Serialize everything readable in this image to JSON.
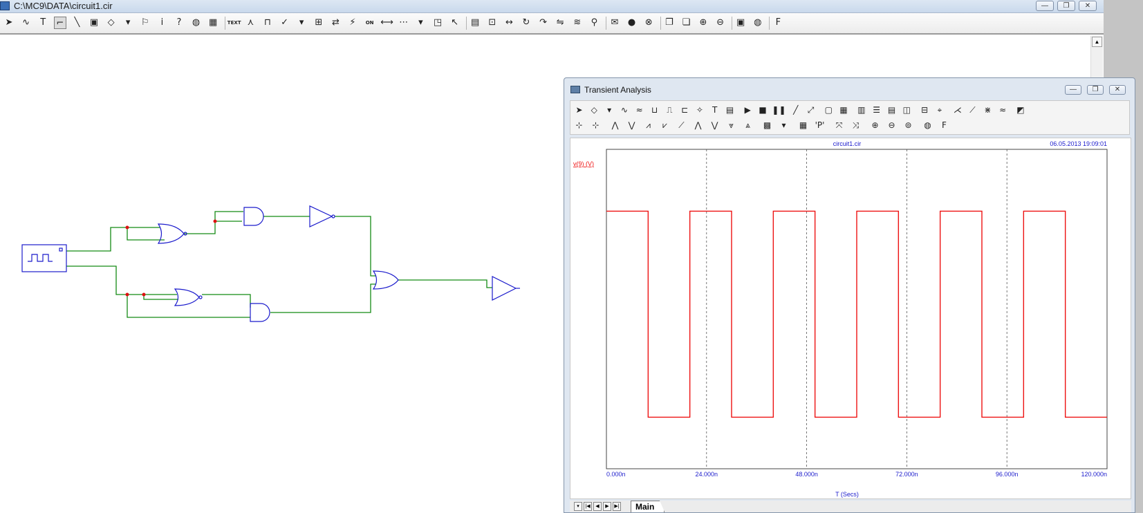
{
  "window": {
    "title": "C:\\MC9\\DATA\\circuit1.cir"
  },
  "main_toolbar": {
    "tools": [
      {
        "name": "select-arrow-icon",
        "glyph": "➤"
      },
      {
        "name": "wire-tilde-icon",
        "glyph": "∿"
      },
      {
        "name": "text-tool-icon",
        "glyph": "T"
      },
      {
        "name": "wire-mode-icon",
        "glyph": "⌐",
        "pressed": true
      },
      {
        "name": "diagonal-wire-icon",
        "glyph": "╲"
      },
      {
        "name": "component-icon",
        "glyph": "▣"
      },
      {
        "name": "shapes-icon",
        "glyph": "◇"
      },
      {
        "name": "dropdown-arrow-icon",
        "glyph": "▾"
      },
      {
        "name": "flag-icon",
        "glyph": "⚐"
      },
      {
        "name": "info-icon",
        "glyph": "i"
      },
      {
        "name": "help-icon",
        "glyph": "?"
      },
      {
        "name": "globe-icon",
        "glyph": "◍"
      },
      {
        "name": "color-grid-icon",
        "glyph": "▦"
      },
      {
        "name": "text-label-icon",
        "glyph": "TEXT",
        "small": true
      },
      {
        "name": "node-numbers-icon",
        "glyph": "⋏"
      },
      {
        "name": "pin-connections-icon",
        "glyph": "⊓"
      },
      {
        "name": "attributes-icon",
        "glyph": "✓"
      },
      {
        "name": "dropdown-arrow-2-icon",
        "glyph": "▾"
      },
      {
        "name": "grid-text-icon",
        "glyph": "⊞"
      },
      {
        "name": "arrows-icon",
        "glyph": "⇄"
      },
      {
        "name": "probe-icon",
        "glyph": "⚡"
      },
      {
        "name": "on-label-icon",
        "glyph": "ON",
        "small": true
      },
      {
        "name": "pin-line-icon",
        "glyph": "⟷"
      },
      {
        "name": "dotted-grid-icon",
        "glyph": "⋯"
      },
      {
        "name": "dropdown-arrow-3-icon",
        "glyph": "▾"
      },
      {
        "name": "border-icon",
        "glyph": "◳"
      },
      {
        "name": "cursor-probe-icon",
        "glyph": "↖"
      },
      {
        "name": "properties-icon",
        "glyph": "▤"
      },
      {
        "name": "mirror-icon",
        "glyph": "⊡"
      },
      {
        "name": "flip-icon",
        "glyph": "↔"
      },
      {
        "name": "rotate-icon",
        "glyph": "↻"
      },
      {
        "name": "step-icon",
        "glyph": "↷"
      },
      {
        "name": "swap-icon",
        "glyph": "⇋"
      },
      {
        "name": "find-wave-icon",
        "glyph": "≋"
      },
      {
        "name": "binoculars-icon",
        "glyph": "⚲"
      },
      {
        "name": "message-icon",
        "glyph": "✉"
      },
      {
        "name": "warning-icon",
        "glyph": "●"
      },
      {
        "name": "stop-icon",
        "glyph": "⊗"
      },
      {
        "name": "copy-page-icon",
        "glyph": "❐"
      },
      {
        "name": "paste-page-icon",
        "glyph": "❏"
      },
      {
        "name": "zoom-in-icon",
        "glyph": "⊕"
      },
      {
        "name": "zoom-out-icon",
        "glyph": "⊖"
      },
      {
        "name": "camera-icon",
        "glyph": "▣"
      },
      {
        "name": "palette-icon",
        "glyph": "◍"
      },
      {
        "name": "font-icon",
        "glyph": "F"
      }
    ]
  },
  "transient": {
    "title": "Transient Analysis",
    "toolbar_row1": [
      {
        "name": "ta-select-icon",
        "glyph": "➤"
      },
      {
        "name": "ta-shapes-icon",
        "glyph": "◇"
      },
      {
        "name": "ta-dropdown-icon",
        "glyph": "▾"
      },
      {
        "name": "ta-wave-icon",
        "glyph": "∿"
      },
      {
        "name": "ta-wave2-icon",
        "glyph": "≈"
      },
      {
        "name": "ta-scope-icon",
        "glyph": "⊔"
      },
      {
        "name": "ta-step-icon",
        "glyph": "⎍"
      },
      {
        "name": "ta-digital-icon",
        "glyph": "⊏"
      },
      {
        "name": "ta-fo-icon",
        "glyph": "✧"
      },
      {
        "name": "ta-text-icon",
        "glyph": "T"
      },
      {
        "name": "ta-properties-icon",
        "glyph": "▤"
      },
      {
        "name": "ta-run-icon",
        "glyph": "▶"
      },
      {
        "name": "ta-stop-icon",
        "glyph": "■"
      },
      {
        "name": "ta-pause-icon",
        "glyph": "❚❚"
      },
      {
        "name": "ta-line-icon",
        "glyph": "╱"
      },
      {
        "name": "ta-curve-icon",
        "glyph": "⤢"
      },
      {
        "name": "ta-frame-icon",
        "glyph": "▢"
      },
      {
        "name": "ta-grid-icon",
        "glyph": "▦"
      },
      {
        "name": "ta-cols-icon",
        "glyph": "▥"
      },
      {
        "name": "ta-rows-icon",
        "glyph": "☰"
      },
      {
        "name": "ta-cells-icon",
        "glyph": "▤"
      },
      {
        "name": "ta-split-icon",
        "glyph": "◫"
      },
      {
        "name": "ta-base-icon",
        "glyph": "⊟"
      },
      {
        "name": "ta-tracker-icon",
        "glyph": "⌖"
      },
      {
        "name": "ta-peak-icon",
        "glyph": "⋌"
      },
      {
        "name": "ta-slope-icon",
        "glyph": "⟋"
      },
      {
        "name": "ta-cross-icon",
        "glyph": "⋇"
      },
      {
        "name": "ta-ghost-icon",
        "glyph": "≈"
      },
      {
        "name": "ta-chart-icon",
        "glyph": "◩"
      }
    ],
    "toolbar_row2": [
      {
        "name": "ta-cursor-left-icon",
        "glyph": "⊹"
      },
      {
        "name": "ta-cursor-right-icon",
        "glyph": "⊹"
      },
      {
        "name": "ta-peak-up-icon",
        "glyph": "⋀"
      },
      {
        "name": "ta-valley-icon",
        "glyph": "⋁"
      },
      {
        "name": "ta-high-icon",
        "glyph": "⩘"
      },
      {
        "name": "ta-low-icon",
        "glyph": "⩗"
      },
      {
        "name": "ta-inflect-icon",
        "glyph": "⟋"
      },
      {
        "name": "ta-global-high-icon",
        "glyph": "⋀"
      },
      {
        "name": "ta-global-low-icon",
        "glyph": "⋁"
      },
      {
        "name": "ta-top-icon",
        "glyph": "⩔"
      },
      {
        "name": "ta-bottom-icon",
        "glyph": "⩓"
      },
      {
        "name": "ta-bundle-icon",
        "glyph": "▩"
      },
      {
        "name": "ta-dropdown2-icon",
        "glyph": "▾"
      },
      {
        "name": "ta-table-icon",
        "glyph": "▦"
      },
      {
        "name": "ta-label-p-icon",
        "glyph": "'P'"
      },
      {
        "name": "ta-scale-x-icon",
        "glyph": "⤧"
      },
      {
        "name": "ta-scale-y-icon",
        "glyph": "⤨"
      },
      {
        "name": "ta-zoom-in-icon",
        "glyph": "⊕"
      },
      {
        "name": "ta-zoom-out-icon",
        "glyph": "⊖"
      },
      {
        "name": "ta-zoom-fit-icon",
        "glyph": "⊚"
      },
      {
        "name": "ta-palette-icon",
        "glyph": "◍"
      },
      {
        "name": "ta-font-icon",
        "glyph": "F"
      }
    ],
    "tab_label": "Main",
    "colors": {
      "trace": "#ee1111",
      "axis_text": "#1a1acc",
      "grid": "#555555"
    }
  },
  "chart_data": {
    "type": "line",
    "title": "circuit1.cir",
    "timestamp": "06.05.2013 19:09:01",
    "series": [
      {
        "name": "v(9) (V)",
        "color": "#ee1111",
        "x": [
          0,
          10,
          10,
          20,
          20,
          30,
          30,
          40,
          40,
          50,
          50,
          60,
          60,
          70,
          70,
          80,
          80,
          90,
          90,
          100,
          100,
          110,
          110,
          120
        ],
        "y": [
          1,
          1,
          0,
          0,
          1,
          1,
          0,
          0,
          1,
          1,
          0,
          0,
          1,
          1,
          0,
          0,
          1,
          1,
          0,
          0,
          1,
          1,
          0,
          0
        ]
      }
    ],
    "x_ticks": [
      "0.000n",
      "24.000n",
      "48.000n",
      "72.000n",
      "96.000n",
      "120.000n"
    ],
    "x_tick_values": [
      0,
      24,
      48,
      72,
      96,
      120
    ],
    "xlabel": "T (Secs)",
    "xlim": [
      0,
      120
    ],
    "ylim": [
      -0.25,
      1.3
    ],
    "grid": "vertical-dashed"
  }
}
